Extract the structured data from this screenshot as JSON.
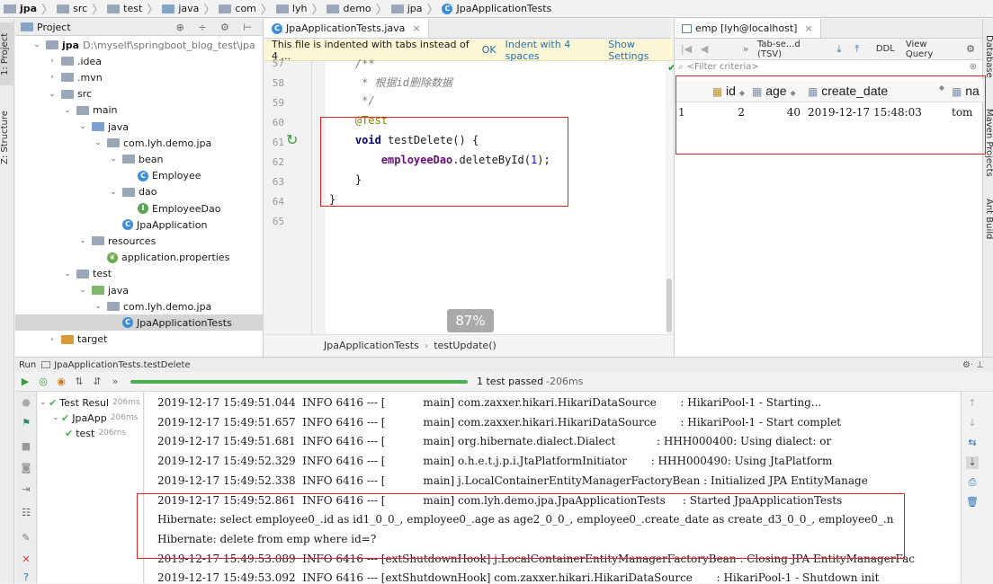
{
  "breadcrumb": [
    "jpa",
    "src",
    "test",
    "java",
    "com",
    "lyh",
    "demo",
    "jpa",
    "JpaApplicationTests"
  ],
  "left_strip": {
    "project": "1: Project",
    "structure": "Z: Structure"
  },
  "right_strip": {
    "database": "Database",
    "maven": "Maven Projects",
    "ant": "Ant Build"
  },
  "project": {
    "header": "Project",
    "tree": [
      {
        "label": "jpa",
        "extra": "D:\\myself\\springboot_blog_test\\jpa",
        "depth": 0,
        "arrow": "v",
        "icon": "folder"
      },
      {
        "label": ".idea",
        "depth": 1,
        "arrow": ">",
        "icon": "folder"
      },
      {
        "label": ".mvn",
        "depth": 1,
        "arrow": ">",
        "icon": "folder"
      },
      {
        "label": "src",
        "depth": 1,
        "arrow": "v",
        "icon": "folder"
      },
      {
        "label": "main",
        "depth": 2,
        "arrow": "v",
        "icon": "folder"
      },
      {
        "label": "java",
        "depth": 3,
        "arrow": "v",
        "icon": "folder-blue"
      },
      {
        "label": "com.lyh.demo.jpa",
        "depth": 4,
        "arrow": "v",
        "icon": "folder"
      },
      {
        "label": "bean",
        "depth": 5,
        "arrow": "v",
        "icon": "folder"
      },
      {
        "label": "Employee",
        "depth": 6,
        "arrow": "",
        "icon": "class"
      },
      {
        "label": "dao",
        "depth": 5,
        "arrow": "v",
        "icon": "folder"
      },
      {
        "label": "EmployeeDao",
        "depth": 6,
        "arrow": "",
        "icon": "interface"
      },
      {
        "label": "JpaApplication",
        "depth": 5,
        "arrow": "",
        "icon": "class"
      },
      {
        "label": "resources",
        "depth": 3,
        "arrow": "v",
        "icon": "folder"
      },
      {
        "label": "application.properties",
        "depth": 4,
        "arrow": "",
        "icon": "leaf"
      },
      {
        "label": "test",
        "depth": 2,
        "arrow": "v",
        "icon": "folder"
      },
      {
        "label": "java",
        "depth": 3,
        "arrow": "v",
        "icon": "folder-green"
      },
      {
        "label": "com.lyh.demo.jpa",
        "depth": 4,
        "arrow": "v",
        "icon": "folder"
      },
      {
        "label": "JpaApplicationTests",
        "depth": 5,
        "arrow": "",
        "icon": "class",
        "selected": true
      },
      {
        "label": "target",
        "depth": 1,
        "arrow": ">",
        "icon": "folder-orange"
      }
    ]
  },
  "editor": {
    "tab": "JpaApplicationTests.java",
    "notice": "This file is indented with tabs instead of 4 ...",
    "notice_ok": "OK",
    "notice_indent": "Indent with 4 spaces",
    "notice_settings": "Show Settings",
    "line_numbers": [
      "57",
      "58",
      "59",
      "60",
      "61",
      "62",
      "63",
      "64",
      "65"
    ],
    "code": {
      "l57": "    /**",
      "l58": "     * 根据id删除数据",
      "l59": "     */",
      "l60": "    @Test",
      "l61_kw": "void",
      "l61_rest": " testDelete() {",
      "l62_field": "employeeDao",
      "l62_rest": ".deleteById(",
      "l62_num": "1",
      "l62_end": ");",
      "l63": "    }",
      "l64": "}"
    },
    "zoom": "87%",
    "crumb_class": "JpaApplicationTests",
    "crumb_method": "testUpdate()"
  },
  "db": {
    "tab": "emp [lyh@localhost]",
    "toolbar_format": "Tab-se...d (TSV)",
    "toolbar_ddl": "DDL",
    "toolbar_view_query": "View Query",
    "filter": "<Filter criteria>",
    "columns": [
      "id",
      "age",
      "create_date",
      "na"
    ],
    "rows": [
      [
        "1",
        "2",
        "40",
        "2019-12-17 15:48:03",
        "tom"
      ]
    ]
  },
  "run": {
    "title": "Run",
    "config": "JpaApplicationTests.testDelete",
    "status": "1 test passed",
    "duration": "206ms",
    "tree": [
      {
        "label": "Test Resul",
        "time": "206ms",
        "depth": 0
      },
      {
        "label": "JpaApp",
        "time": "206ms",
        "depth": 1
      },
      {
        "label": "test",
        "time": "206ms",
        "depth": 2
      }
    ],
    "log": [
      "2019-12-17 15:49:51.044  INFO 6416 --- [           main] com.zaxxer.hikari.HikariDataSource       : HikariPool-1 - Starting...",
      "2019-12-17 15:49:51.657  INFO 6416 --- [           main] com.zaxxer.hikari.HikariDataSource       : HikariPool-1 - Start complet",
      "2019-12-17 15:49:51.681  INFO 6416 --- [           main] org.hibernate.dialect.Dialect            : HHH000400: Using dialect: or",
      "2019-12-17 15:49:52.329  INFO 6416 --- [           main] o.h.e.t.j.p.i.JtaPlatformInitiator       : HHH000490: Using JtaPlatform",
      "2019-12-17 15:49:52.338  INFO 6416 --- [           main] j.LocalContainerEntityManagerFactoryBean : Initialized JPA EntityManage",
      "2019-12-17 15:49:52.861  INFO 6416 --- [           main] com.lyh.demo.jpa.JpaApplicationTests     : Started JpaApplicationTests",
      "Hibernate: select employee0_.id as id1_0_0_, employee0_.age as age2_0_0_, employee0_.create_date as create_d3_0_0_, employee0_.n",
      "Hibernate: delete from emp where id=?",
      "2019-12-17 15:49:53.089  INFO 6416 --- [extShutdownHook] j.LocalContainerEntityManagerFactoryBean : Closing JPA EntityManagerFac",
      "2019-12-17 15:49:53.092  INFO 6416 --- [extShutdownHook] com.zaxxer.hikari.HikariDataSource       : HikariPool-1 - Shutdown init"
    ]
  },
  "colors": {
    "accent": "#3f8fd6",
    "highlight_box": "#e02424",
    "pass": "#4caf50"
  }
}
